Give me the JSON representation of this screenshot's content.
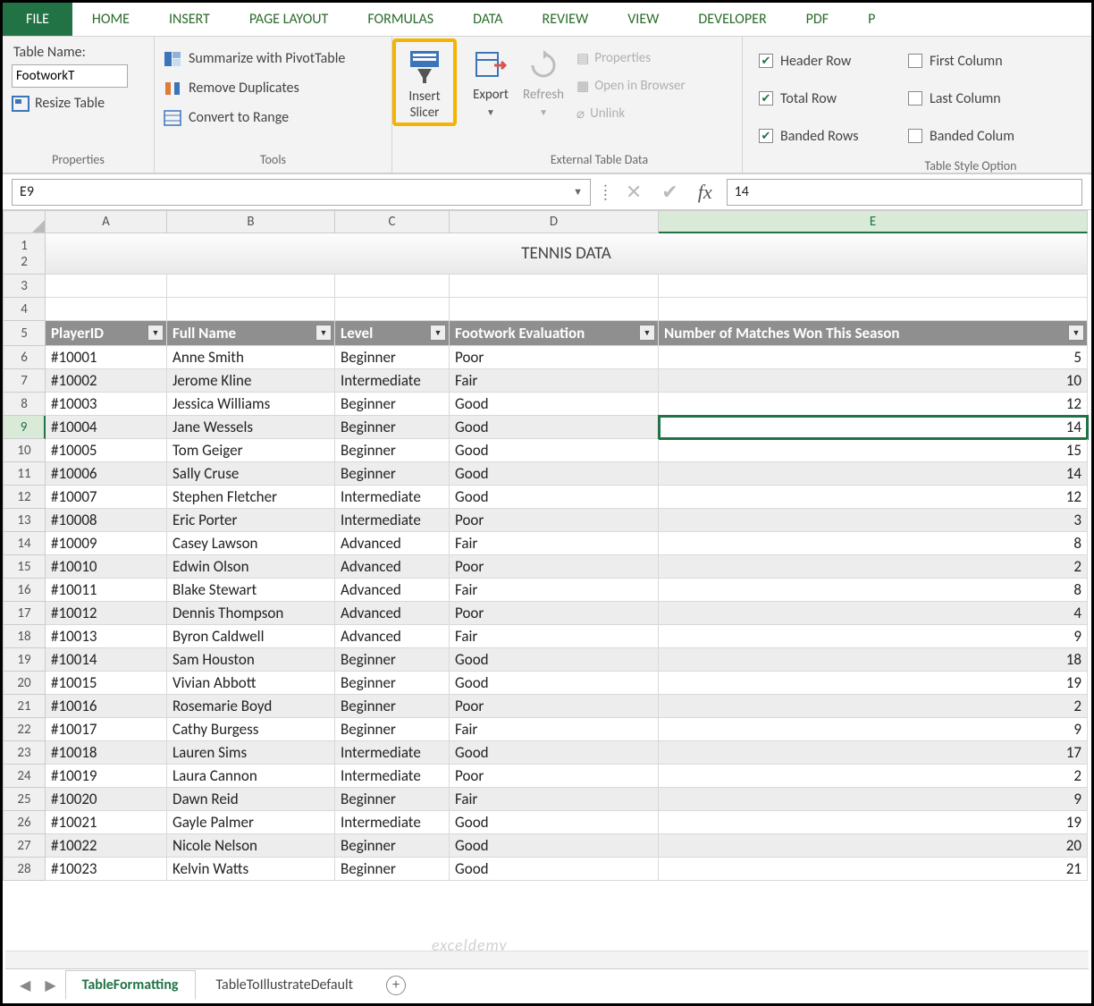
{
  "tabs": {
    "file": "FILE",
    "items": [
      "HOME",
      "INSERT",
      "PAGE LAYOUT",
      "FORMULAS",
      "DATA",
      "REVIEW",
      "VIEW",
      "DEVELOPER",
      "PDF",
      "P"
    ]
  },
  "ribbon": {
    "properties": {
      "label": "Properties",
      "table_name_label": "Table Name:",
      "table_name_value": "FootworkT",
      "resize": "Resize Table"
    },
    "tools": {
      "label": "Tools",
      "pivot": "Summarize with PivotTable",
      "dupes": "Remove Duplicates",
      "range": "Convert to Range"
    },
    "slicer": {
      "line1": "Insert",
      "line2": "Slicer"
    },
    "export": "Export",
    "refresh": "Refresh",
    "external": {
      "label": "External Table Data",
      "props": "Properties",
      "open": "Open in Browser",
      "unlink": "Unlink"
    },
    "style_options": {
      "label": "Table Style Option",
      "header_row": "Header Row",
      "total_row": "Total Row",
      "banded_rows": "Banded Rows",
      "first_col": "First Column",
      "last_col": "Last Column",
      "banded_cols": "Banded Colum"
    }
  },
  "formula_bar": {
    "namebox": "E9",
    "value": "14"
  },
  "columns": [
    "A",
    "B",
    "C",
    "D",
    "E"
  ],
  "title": "TENNIS DATA",
  "headers": [
    "PlayerID",
    "Full Name",
    "Level",
    "Footwork Evaluation",
    "Number of Matches Won This Season"
  ],
  "rows": [
    {
      "n": 6,
      "d": [
        "#10001",
        "Anne Smith",
        "Beginner",
        "Poor",
        "5"
      ]
    },
    {
      "n": 7,
      "d": [
        "#10002",
        "Jerome Kline",
        "Intermediate",
        "Fair",
        "10"
      ]
    },
    {
      "n": 8,
      "d": [
        "#10003",
        "Jessica Williams",
        "Beginner",
        "Good",
        "12"
      ]
    },
    {
      "n": 9,
      "d": [
        "#10004",
        "Jane Wessels",
        "Beginner",
        "Good",
        "14"
      ]
    },
    {
      "n": 10,
      "d": [
        "#10005",
        "Tom Geiger",
        "Beginner",
        "Good",
        "15"
      ]
    },
    {
      "n": 11,
      "d": [
        "#10006",
        "Sally Cruse",
        "Beginner",
        "Good",
        "14"
      ]
    },
    {
      "n": 12,
      "d": [
        "#10007",
        "Stephen Fletcher",
        "Intermediate",
        "Good",
        "12"
      ]
    },
    {
      "n": 13,
      "d": [
        "#10008",
        "Eric Porter",
        "Intermediate",
        "Poor",
        "3"
      ]
    },
    {
      "n": 14,
      "d": [
        "#10009",
        "Casey Lawson",
        "Advanced",
        "Fair",
        "8"
      ]
    },
    {
      "n": 15,
      "d": [
        "#10010",
        "Edwin Olson",
        "Advanced",
        "Poor",
        "2"
      ]
    },
    {
      "n": 16,
      "d": [
        "#10011",
        "Blake Stewart",
        "Advanced",
        "Fair",
        "8"
      ]
    },
    {
      "n": 17,
      "d": [
        "#10012",
        "Dennis Thompson",
        "Advanced",
        "Poor",
        "4"
      ]
    },
    {
      "n": 18,
      "d": [
        "#10013",
        "Byron Caldwell",
        "Advanced",
        "Fair",
        "9"
      ]
    },
    {
      "n": 19,
      "d": [
        "#10014",
        "Sam Houston",
        "Beginner",
        "Good",
        "18"
      ]
    },
    {
      "n": 20,
      "d": [
        "#10015",
        "Vivian Abbott",
        "Beginner",
        "Good",
        "19"
      ]
    },
    {
      "n": 21,
      "d": [
        "#10016",
        "Rosemarie Boyd",
        "Beginner",
        "Poor",
        "2"
      ]
    },
    {
      "n": 22,
      "d": [
        "#10017",
        "Cathy Burgess",
        "Beginner",
        "Fair",
        "9"
      ]
    },
    {
      "n": 23,
      "d": [
        "#10018",
        "Lauren Sims",
        "Intermediate",
        "Good",
        "17"
      ]
    },
    {
      "n": 24,
      "d": [
        "#10019",
        "Laura Cannon",
        "Intermediate",
        "Poor",
        "2"
      ]
    },
    {
      "n": 25,
      "d": [
        "#10020",
        "Dawn Reid",
        "Beginner",
        "Fair",
        "9"
      ]
    },
    {
      "n": 26,
      "d": [
        "#10021",
        "Gayle Palmer",
        "Intermediate",
        "Good",
        "19"
      ]
    },
    {
      "n": 27,
      "d": [
        "#10022",
        "Nicole Nelson",
        "Beginner",
        "Good",
        "20"
      ]
    },
    {
      "n": 28,
      "d": [
        "#10023",
        "Kelvin Watts",
        "Beginner",
        "Good",
        "21"
      ]
    }
  ],
  "selected_cell": {
    "row": 9,
    "col": "E"
  },
  "sheets": {
    "active": "TableFormatting",
    "other": "TableToIllustrateDefault"
  },
  "watermark": "exceldemy"
}
